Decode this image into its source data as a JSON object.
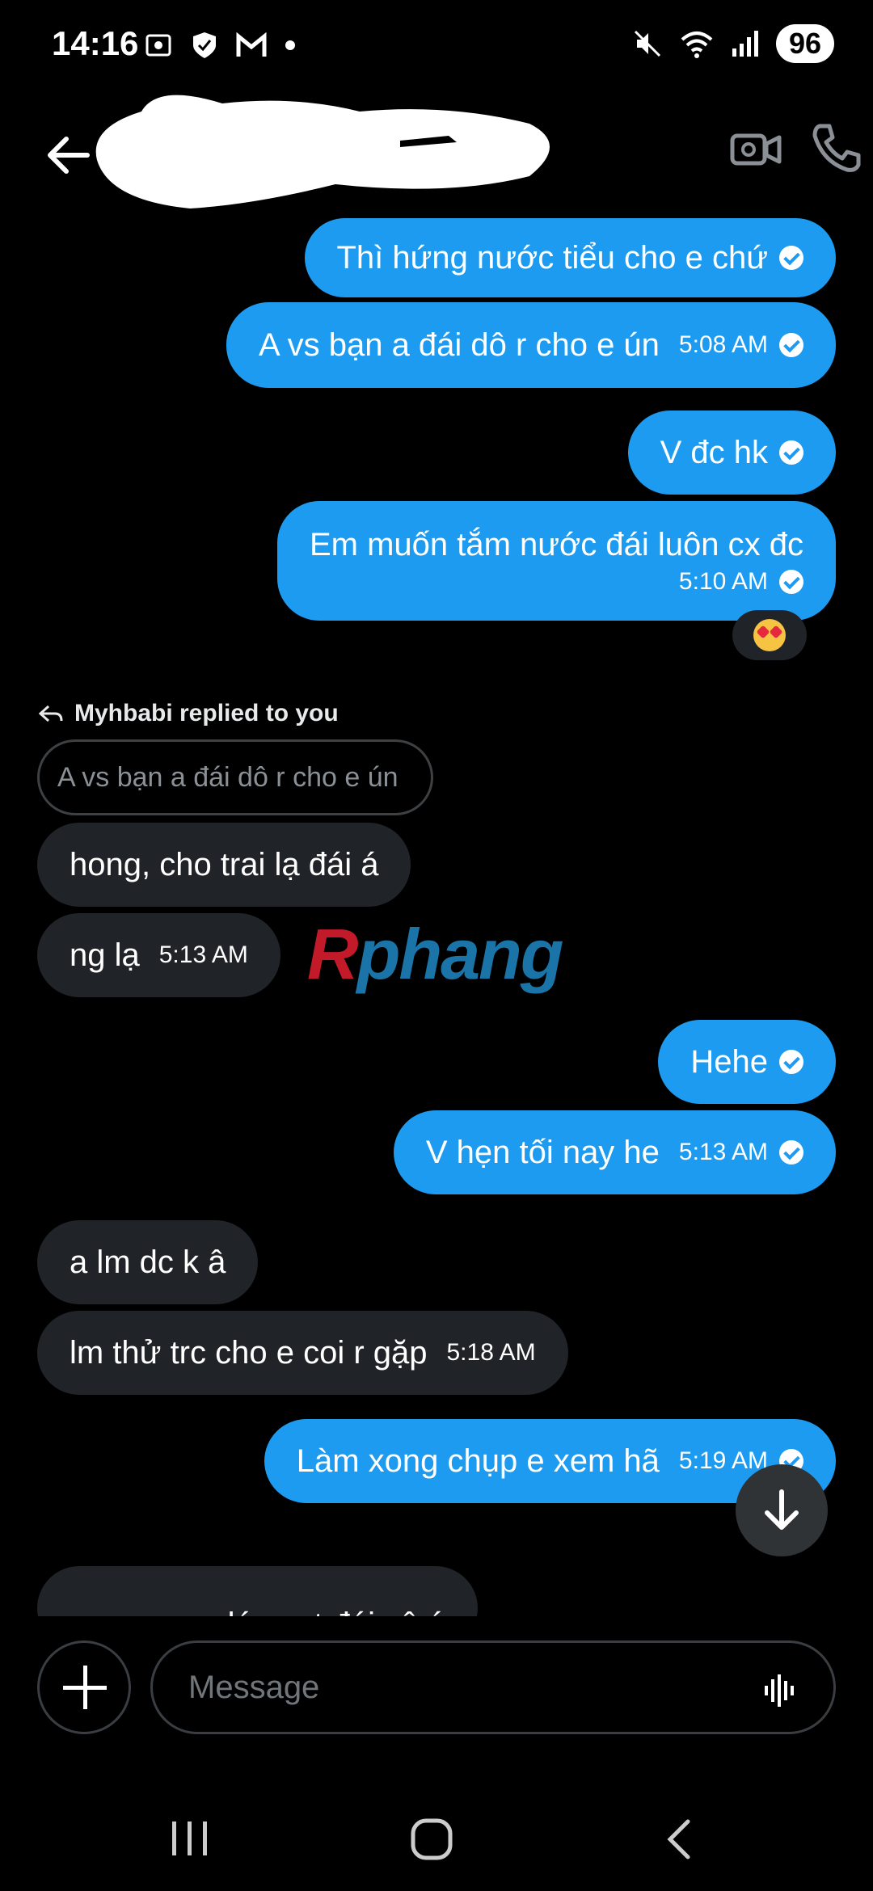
{
  "status_bar": {
    "time": "14:16",
    "battery": "96"
  },
  "header": {
    "contact_name": ""
  },
  "messages": [
    {
      "id": "m1",
      "direction": "out",
      "text": "Thì hứng nước tiểu cho e chứ",
      "time": ""
    },
    {
      "id": "m2",
      "direction": "out",
      "text": "A vs bạn a đái dô r cho e ún",
      "time": "5:08 AM"
    },
    {
      "id": "m3",
      "direction": "out",
      "text": "V đc hk",
      "time": ""
    },
    {
      "id": "m4",
      "direction": "out",
      "text": "Em muốn tắm nước đái luôn cx đc",
      "time": "5:10 AM"
    },
    {
      "id": "m5",
      "direction": "in",
      "text": "hong, cho trai lạ đái á",
      "time": ""
    },
    {
      "id": "m6",
      "direction": "in",
      "text": "ng lạ",
      "time": "5:13 AM"
    },
    {
      "id": "m7",
      "direction": "out",
      "text": "Hehe",
      "time": ""
    },
    {
      "id": "m8",
      "direction": "out",
      "text": "V hẹn tối nay he",
      "time": "5:13 AM"
    },
    {
      "id": "m9",
      "direction": "in",
      "text": "a lm dc k â",
      "time": ""
    },
    {
      "id": "m10",
      "direction": "in",
      "text": "lm thử trc cho e coi r gặp",
      "time": "5:18 AM"
    },
    {
      "id": "m11",
      "direction": "out",
      "text": "Làm xong chụp e xem hã",
      "time": "5:19 AM"
    },
    {
      "id": "m12",
      "direction": "in",
      "text": "gay e xem lúc ngt đái vô á",
      "time": ""
    }
  ],
  "reply_context": {
    "label": "Myhbabi replied to you",
    "quoted": "A vs bạn a đái dô r cho e ún"
  },
  "reaction": {
    "emoji": "heart-eyes"
  },
  "watermark": {
    "first": "R",
    "rest": "phang"
  },
  "composer": {
    "placeholder": "Message"
  },
  "colors": {
    "outgoing": "#1d9bf0",
    "incoming": "#202327",
    "background": "#000000"
  }
}
